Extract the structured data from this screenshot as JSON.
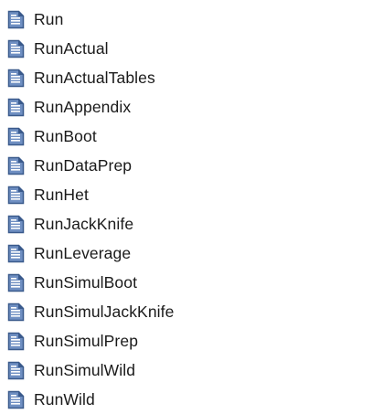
{
  "file_list": {
    "icon": "document-icon",
    "items": [
      {
        "label": "Run"
      },
      {
        "label": "RunActual"
      },
      {
        "label": "RunActualTables"
      },
      {
        "label": "RunAppendix"
      },
      {
        "label": "RunBoot"
      },
      {
        "label": "RunDataPrep"
      },
      {
        "label": "RunHet"
      },
      {
        "label": "RunJackKnife"
      },
      {
        "label": "RunLeverage"
      },
      {
        "label": "RunSimulBoot"
      },
      {
        "label": "RunSimulJackKnife"
      },
      {
        "label": "RunSimulPrep"
      },
      {
        "label": "RunSimulWild"
      },
      {
        "label": "RunWild"
      }
    ]
  },
  "colors": {
    "icon_dark": "#3a5a8c",
    "icon_light": "#6f8fc2",
    "icon_lines": "#ffffff",
    "text": "#1a1a1a"
  }
}
